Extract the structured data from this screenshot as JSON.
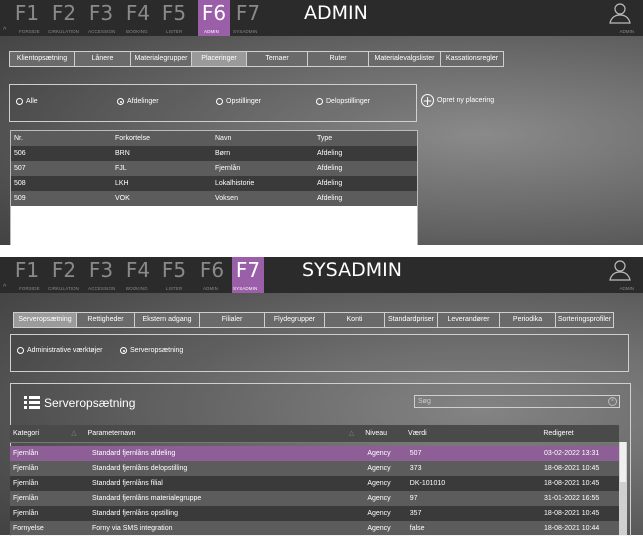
{
  "screens": [
    {
      "fkeys": [
        {
          "key": "F1",
          "label": "FORSIDE"
        },
        {
          "key": "F2",
          "label": "CIRKULATION"
        },
        {
          "key": "F3",
          "label": "ACCESSION"
        },
        {
          "key": "F4",
          "label": "BOOKING"
        },
        {
          "key": "F5",
          "label": "LISTER"
        },
        {
          "key": "F6",
          "label": "ADMIN"
        },
        {
          "key": "F7",
          "label": "SYSADMIN"
        }
      ],
      "active_key": "F6",
      "title": "ADMIN",
      "user_label": "ADMIN",
      "tabs": [
        "Klientopsætning",
        "Lånere",
        "Materialegrupper",
        "Placeringer",
        "Temaer",
        "Ruter",
        "Materialevalgslister",
        "Kassationsregler"
      ],
      "active_tab": "Placeringer",
      "radios": [
        {
          "label": "Alle",
          "checked": false
        },
        {
          "label": "Afdelinger",
          "checked": true
        },
        {
          "label": "Opstillinger",
          "checked": false
        },
        {
          "label": "Delopstillinger",
          "checked": false
        }
      ],
      "new_placement_label": "Opret ny placering",
      "table": {
        "columns": [
          "Nr.",
          "Forkortelse",
          "Navn",
          "Type"
        ],
        "rows": [
          [
            "506",
            "BRN",
            "Børn",
            "Afdeling"
          ],
          [
            "507",
            "FJL",
            "Fjernlån",
            "Afdeling"
          ],
          [
            "508",
            "LKH",
            "Lokalhistorie",
            "Afdeling"
          ],
          [
            "509",
            "VOK",
            "Voksen",
            "Afdeling"
          ]
        ]
      }
    },
    {
      "fkeys": [
        {
          "key": "F1",
          "label": "FORSIDE"
        },
        {
          "key": "F2",
          "label": "CIRKULATION"
        },
        {
          "key": "F3",
          "label": "ACCESSION"
        },
        {
          "key": "F4",
          "label": "BOOKING"
        },
        {
          "key": "F5",
          "label": "LISTER"
        },
        {
          "key": "F6",
          "label": "ADMIN"
        },
        {
          "key": "F7",
          "label": "SYSADMIN"
        }
      ],
      "active_key": "F7",
      "title": "SYSADMIN",
      "user_label": "ADMIN",
      "tabs": [
        "Serveropsætning",
        "Rettigheder",
        "Ekstern adgang",
        "Filialer",
        "Flydegrupper",
        "Konti",
        "Standardpriser",
        "Leverandører",
        "Periodika",
        "Sorteringsprofiler"
      ],
      "active_tab": "Serveropsætning",
      "radios": [
        {
          "label": "Administrative værktøjer",
          "checked": false
        },
        {
          "label": "Serveropsætning",
          "checked": true
        }
      ],
      "section_title": "Serveropsætning",
      "search_placeholder": "Søg",
      "table": {
        "columns": [
          "Kategori",
          "Parameternavn",
          "Niveau",
          "Værdi",
          "Redigeret"
        ],
        "rows": [
          [
            "Fjernlån",
            "Standard fjernlåns afdeling",
            "Agency",
            "507",
            "03-02-2022 13:31"
          ],
          [
            "Fjernlån",
            "Standard fjernlåns delopstilling",
            "Agency",
            "373",
            "18-08-2021 10:45"
          ],
          [
            "Fjernlån",
            "Standard fjernlåns filial",
            "Agency",
            "DK-101010",
            "18-08-2021 10:45"
          ],
          [
            "Fjernlån",
            "Standard fjernlåns materialegruppe",
            "Agency",
            "97",
            "31-01-2022 16:55"
          ],
          [
            "Fjernlån",
            "Standard fjernlåns opstilling",
            "Agency",
            "357",
            "18-08-2021 10:45"
          ],
          [
            "Fornyelse",
            "Forny via SMS integration",
            "Agency",
            "false",
            "18-08-2021 10:44"
          ]
        ]
      }
    }
  ],
  "colors": {
    "accent": "#9b5ea8",
    "topbar": "#2b2b2b",
    "row_dark": "#3a3a3a",
    "row_light": "#5c5c5c",
    "row_selected": "#8e5f96"
  }
}
